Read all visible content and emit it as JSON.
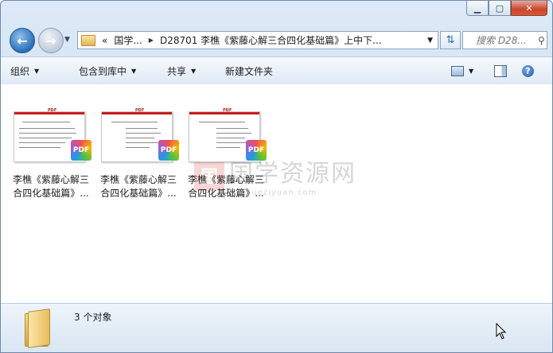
{
  "window": {
    "minimize_label": "▁",
    "maximize_label": "▢",
    "close_label": "✕"
  },
  "navigation": {
    "back_icon": "left-arrow-icon",
    "forward_icon": "right-arrow-icon",
    "breadcrumb_overflow": "«",
    "breadcrumb": [
      "国学...",
      "D28701 李樵《紫藤心解三合四化基础篇》上中下..."
    ],
    "search_placeholder": "搜索 D28..."
  },
  "toolbar": {
    "organize": "组织",
    "include_in_library": "包含到库中",
    "share": "共享",
    "new_folder": "新建文件夹"
  },
  "files": [
    {
      "name": "李樵《紫藤心解三合四化基础篇》...",
      "type": "PDF"
    },
    {
      "name": "李樵《紫藤心解三合四化基础篇》...",
      "type": "PDF"
    },
    {
      "name": "李樵《紫藤心解三合四化基础篇》...",
      "type": "PDF"
    }
  ],
  "watermark": {
    "logo": "国",
    "text": "国学资源网",
    "url": "guoxueziyuan.com"
  },
  "status": {
    "object_count": "3 个对象"
  }
}
